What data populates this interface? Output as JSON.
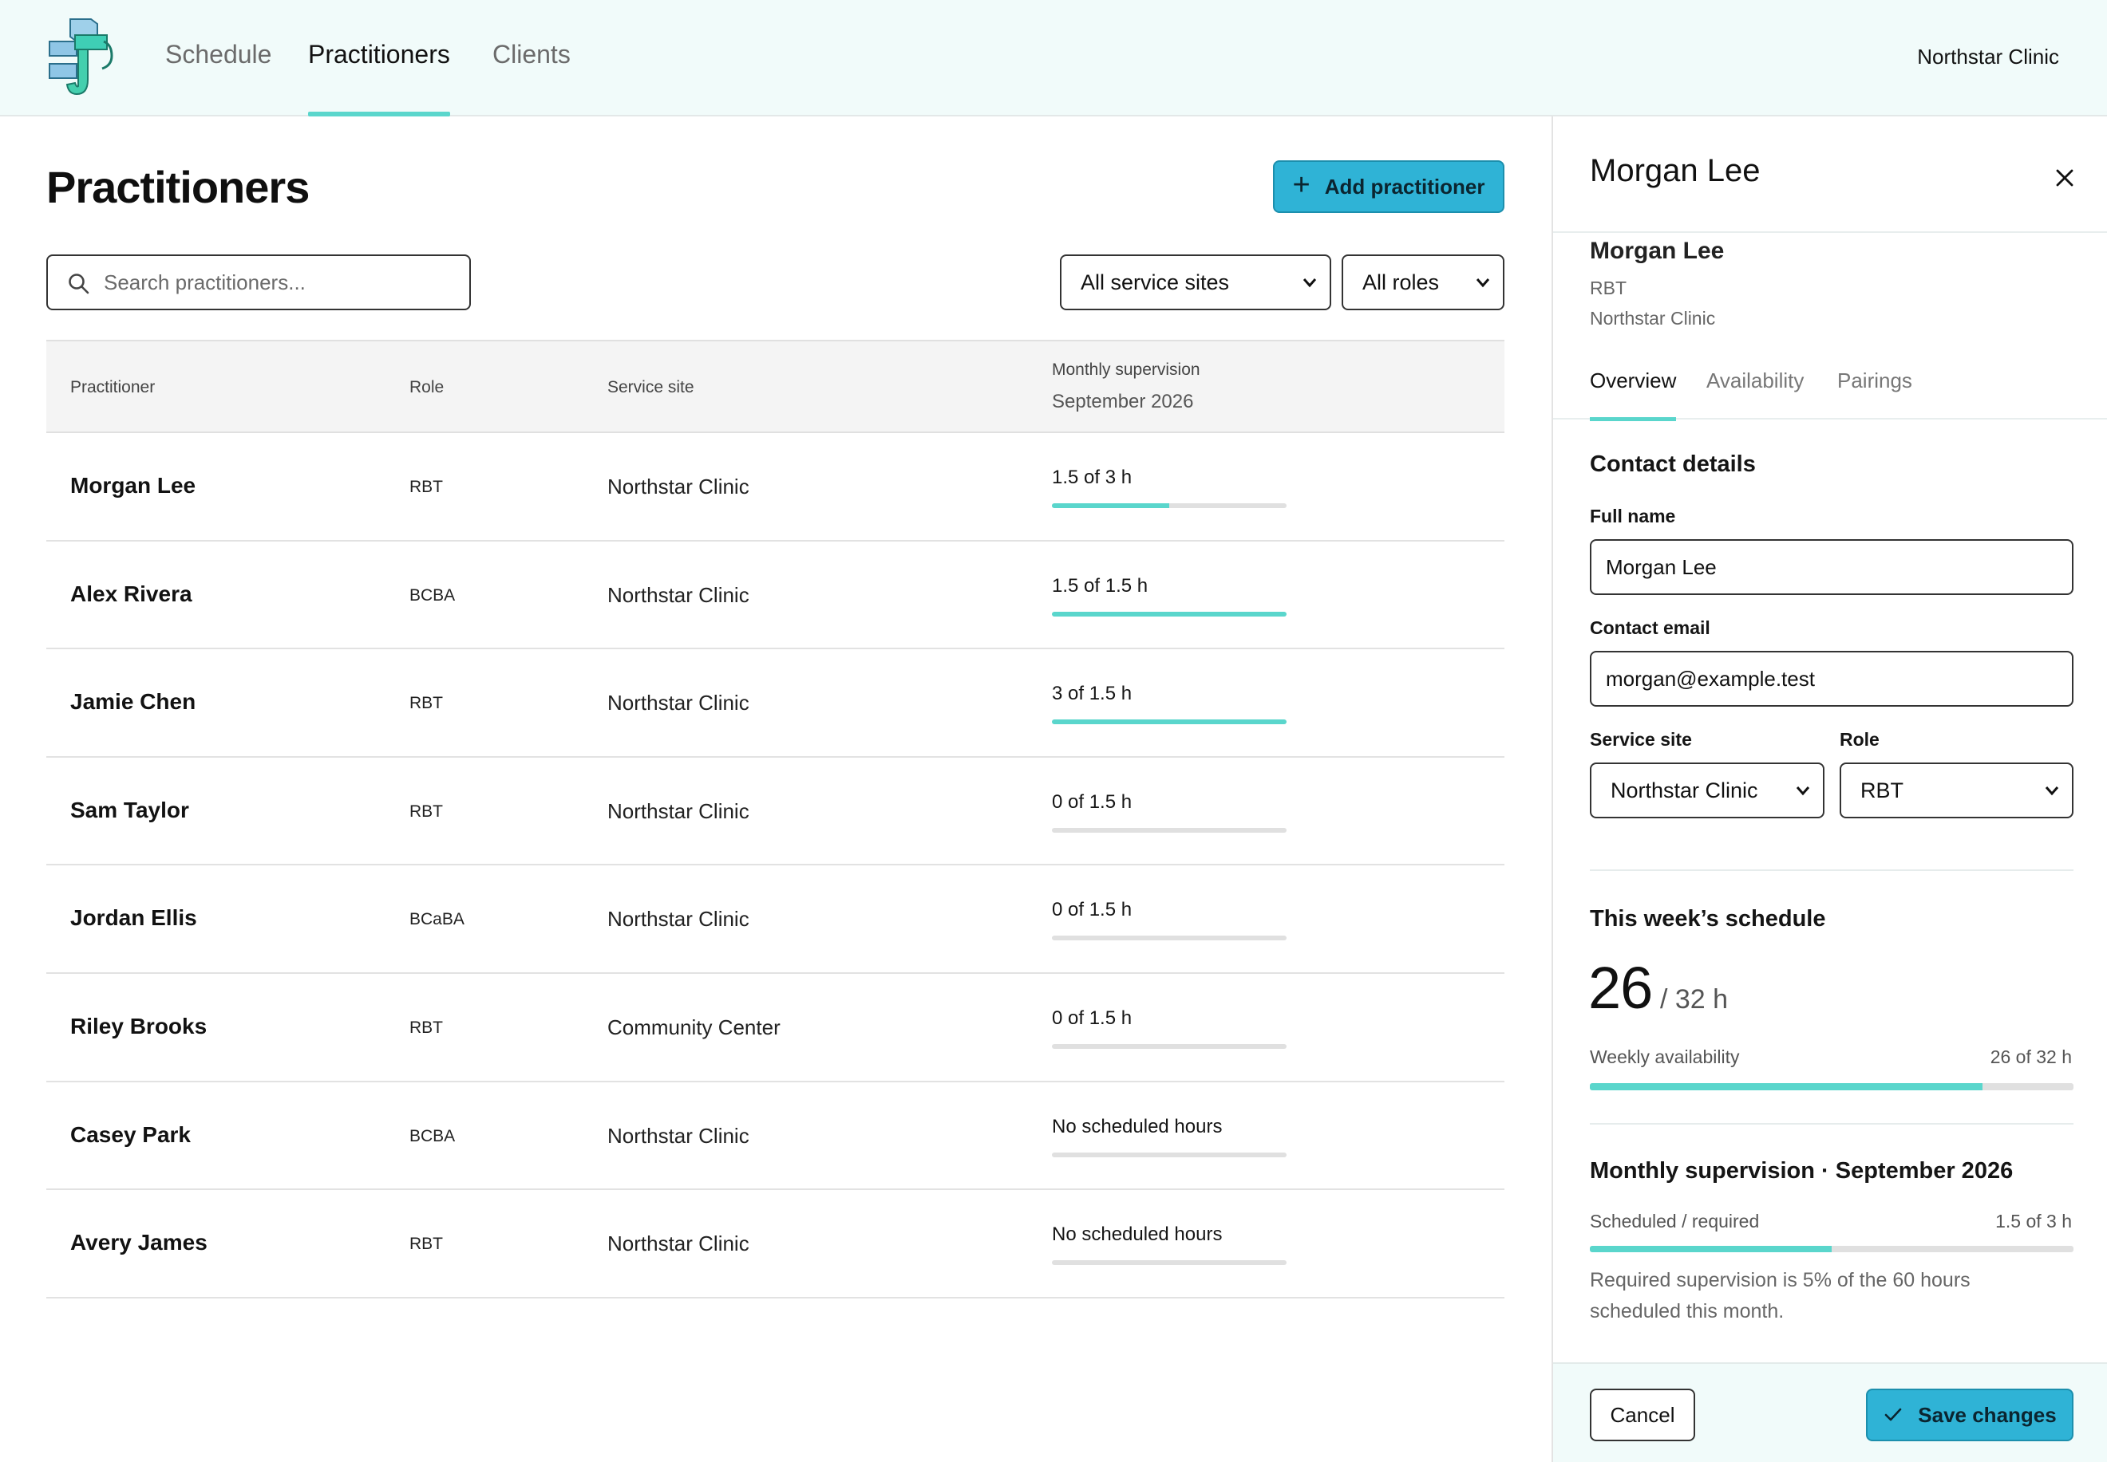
{
  "nav": {
    "logo_icon": "stacked-blocks-logo-icon",
    "tabs": [
      {
        "label": "Schedule",
        "active": false
      },
      {
        "label": "Practitioners",
        "active": true
      },
      {
        "label": "Clients",
        "active": false
      }
    ],
    "org_name": "Northstar Clinic"
  },
  "main": {
    "title": "Practitioners",
    "add_button": {
      "icon": "plus-icon",
      "label": "Add practitioner"
    },
    "search": {
      "placeholder": "Search practitioners..."
    },
    "filters": {
      "site": "All service sites",
      "role": "All roles"
    },
    "table": {
      "headers": {
        "name": "Practitioner",
        "role": "Role",
        "site": "Service site",
        "supervision": "Monthly supervision",
        "supervision_month": "September 2026"
      },
      "rows": [
        {
          "name": "Morgan Lee",
          "role": "RBT",
          "site": "Northstar Clinic",
          "supervision": "1.5 of 3 h",
          "progress": 0.5
        },
        {
          "name": "Alex Rivera",
          "role": "BCBA",
          "site": "Northstar Clinic",
          "supervision": "1.5 of 1.5 h",
          "progress": 1.0
        },
        {
          "name": "Jamie Chen",
          "role": "RBT",
          "site": "Northstar Clinic",
          "supervision": "3 of 1.5 h",
          "progress": 1.0
        },
        {
          "name": "Sam Taylor",
          "role": "RBT",
          "site": "Northstar Clinic",
          "supervision": "0 of 1.5 h",
          "progress": 0
        },
        {
          "name": "Jordan Ellis",
          "role": "BCaBA",
          "site": "Northstar Clinic",
          "supervision": "0 of 1.5 h",
          "progress": 0
        },
        {
          "name": "Riley Brooks",
          "role": "RBT",
          "site": "Community Center",
          "supervision": "0 of 1.5 h",
          "progress": 0
        },
        {
          "name": "Casey Park",
          "role": "BCBA",
          "site": "Northstar Clinic",
          "supervision": "No scheduled hours",
          "progress": 0
        },
        {
          "name": "Avery James",
          "role": "RBT",
          "site": "Northstar Clinic",
          "supervision": "No scheduled hours",
          "progress": 0
        }
      ]
    }
  },
  "panel": {
    "title": "Morgan Lee",
    "close_icon": "close-icon",
    "profile": {
      "name": "Morgan Lee",
      "role": "RBT",
      "site": "Northstar Clinic"
    },
    "tabs": [
      {
        "label": "Overview",
        "active": true
      },
      {
        "label": "Availability",
        "active": false
      },
      {
        "label": "Pairings",
        "active": false
      }
    ],
    "contact": {
      "title": "Contact details",
      "full_name_label": "Full name",
      "full_name_value": "Morgan Lee",
      "email_label": "Contact email",
      "email_value": "morgan@example.test",
      "site_label": "Service site",
      "site_value": "Northstar Clinic",
      "role_label": "Role",
      "role_value": "RBT"
    },
    "schedule": {
      "title": "This week’s schedule",
      "hours": "26",
      "total": "/ 32 h",
      "avail_label": "Weekly availability",
      "avail_value": "26 of 32 h",
      "progress": 0.8125
    },
    "supervision": {
      "title": "Monthly supervision · September 2026",
      "label": "Scheduled / required",
      "value": "1.5 of 3 h",
      "progress": 0.5,
      "note": "Required supervision is 5% of the 60 hours scheduled this month."
    },
    "footer": {
      "cancel_label": "Cancel",
      "save_label": "Save changes",
      "save_icon": "check-icon"
    }
  },
  "colors": {
    "accent": "#5ad6cc",
    "primary_button": "#2fb3d6",
    "topbar_bg": "#f1fbfa"
  }
}
